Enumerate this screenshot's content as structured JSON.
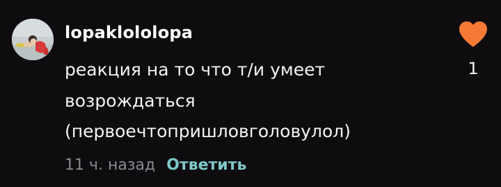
{
  "comment": {
    "username": "lopaklololopa",
    "text_lines": [
      "реакция на то что т/и умеет",
      "возрождаться",
      "(первоечтопришловголовулол)"
    ],
    "timestamp": "11 ч. назад",
    "reply_label": "Ответить",
    "like_count": "1",
    "like_icon": "heart-icon",
    "colors": {
      "heart": "#f47a36",
      "reply": "#7fc8c8",
      "timestamp": "#8a8a8e",
      "background": "#0e0c0f"
    }
  }
}
